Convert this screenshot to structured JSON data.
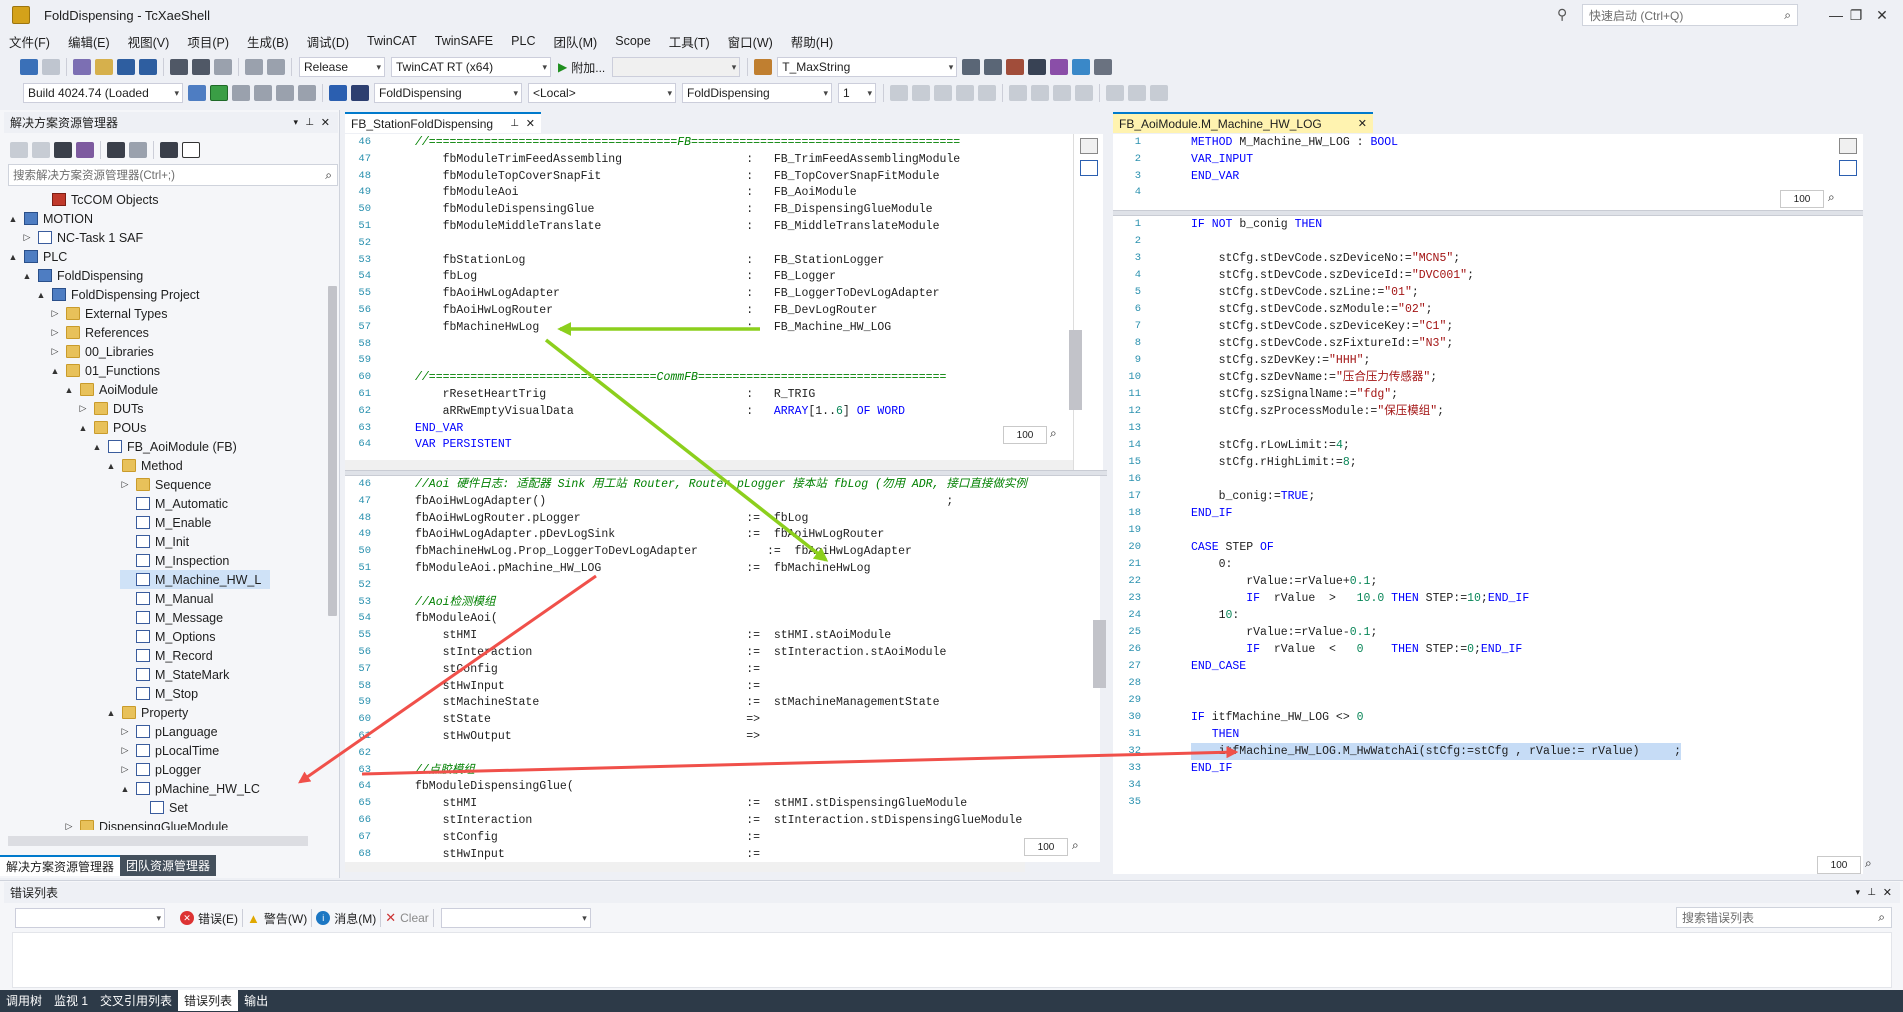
{
  "window": {
    "title": "FoldDispensing - TcXaeShell",
    "quick_launch_placeholder": "快速启动 (Ctrl+Q)"
  },
  "menu": [
    "文件(F)",
    "编辑(E)",
    "视图(V)",
    "项目(P)",
    "生成(B)",
    "调试(D)",
    "TwinCAT",
    "TwinSAFE",
    "PLC",
    "团队(M)",
    "Scope",
    "工具(T)",
    "窗口(W)",
    "帮助(H)"
  ],
  "toolbar1": {
    "config": "Release",
    "platform": "TwinCAT RT (x64)",
    "attach": "附加...",
    "symbol": "T_MaxString"
  },
  "toolbar2": {
    "build": "Build 4024.74 (Loaded",
    "project": "FoldDispensing",
    "target": "<Local>",
    "plc_project": "FoldDispensing",
    "instance": "1"
  },
  "solution_explorer": {
    "title": "解决方案资源管理器",
    "search_placeholder": "搜索解决方案资源管理器(Ctrl+;)",
    "nodes": [
      {
        "label": "TcCOM Objects"
      },
      {
        "label": "MOTION"
      },
      {
        "label": "NC-Task 1 SAF"
      },
      {
        "label": "PLC"
      },
      {
        "label": "FoldDispensing"
      },
      {
        "label": "FoldDispensing Project"
      },
      {
        "label": "External Types"
      },
      {
        "label": "References"
      },
      {
        "label": "00_Libraries"
      },
      {
        "label": "01_Functions"
      },
      {
        "label": "AoiModule"
      },
      {
        "label": "DUTs"
      },
      {
        "label": "POUs"
      },
      {
        "label": "FB_AoiModule (FB)"
      },
      {
        "label": "Method"
      },
      {
        "label": "Sequence"
      },
      {
        "label": "M_Automatic"
      },
      {
        "label": "M_Enable"
      },
      {
        "label": "M_Init"
      },
      {
        "label": "M_Inspection"
      },
      {
        "label": "M_Machine_HW_L"
      },
      {
        "label": "M_Manual"
      },
      {
        "label": "M_Message"
      },
      {
        "label": "M_Options"
      },
      {
        "label": "M_Record"
      },
      {
        "label": "M_StateMark"
      },
      {
        "label": "M_Stop"
      },
      {
        "label": "Property"
      },
      {
        "label": "pLanguage"
      },
      {
        "label": "pLocalTime"
      },
      {
        "label": "pLogger"
      },
      {
        "label": "pMachine_HW_LC"
      },
      {
        "label": "Set"
      },
      {
        "label": "DispensingGlueModule"
      }
    ],
    "bottom_tabs": [
      "解决方案资源管理器",
      "团队资源管理器"
    ]
  },
  "editor_left": {
    "tab": "FB_StationFoldDispensing",
    "zoom": "100",
    "top_lines": [
      {
        "n": "46",
        "t": "//====================================FB======================================="
      },
      {
        "n": "47",
        "t": "    fbModuleTrimFeedAssembling                  :   FB_TrimFeedAssemblingModule"
      },
      {
        "n": "48",
        "t": "    fbModuleTopCoverSnapFit                     :   FB_TopCoverSnapFitModule"
      },
      {
        "n": "49",
        "t": "    fbModuleAoi                                 :   FB_AoiModule"
      },
      {
        "n": "50",
        "t": "    fbModuleDispensingGlue                      :   FB_DispensingGlueModule"
      },
      {
        "n": "51",
        "t": "    fbModuleMiddleTranslate                     :   FB_MiddleTranslateModule"
      },
      {
        "n": "52",
        "t": ""
      },
      {
        "n": "53",
        "t": "    fbStationLog                                :   FB_StationLogger"
      },
      {
        "n": "54",
        "t": "    fbLog                                       :   FB_Logger"
      },
      {
        "n": "55",
        "t": "    fbAoiHwLogAdapter                           :   FB_LoggerToDevLogAdapter"
      },
      {
        "n": "56",
        "t": "    fbAoiHwLogRouter                            :   FB_DevLogRouter"
      },
      {
        "n": "57",
        "t": "    fbMachineHwLog                              :   FB_Machine_HW_LOG"
      },
      {
        "n": "58",
        "t": ""
      },
      {
        "n": "59",
        "t": ""
      },
      {
        "n": "60",
        "t": "//=================================CommFB===================================="
      },
      {
        "n": "61",
        "t": "    rResetHeartTrig                             :   R_TRIG"
      },
      {
        "n": "62",
        "t": "    aRRwEmptyVisualData                         :   ARRAY[1..6] OF WORD"
      },
      {
        "n": "63",
        "t": "END_VAR"
      },
      {
        "n": "64",
        "t": "VAR PERSISTENT"
      }
    ],
    "bottom_lines": [
      {
        "n": "46",
        "t": "//Aoi 硬件日志: 适配器 Sink 用工站 Router, Router.pLogger 接本站 fbLog (勿用 ADR, 接口直接做实例"
      },
      {
        "n": "47",
        "t": "fbAoiHwLogAdapter()                                                          ;"
      },
      {
        "n": "48",
        "t": "fbAoiHwLogRouter.pLogger                        :=  fbLog"
      },
      {
        "n": "49",
        "t": "fbAoiHwLogAdapter.pDevLogSink                   :=  fbAoiHwLogRouter"
      },
      {
        "n": "50",
        "t": "fbMachineHwLog.Prop_LoggerToDevLogAdapter          :=  fbAoiHwLogAdapter"
      },
      {
        "n": "51",
        "t": "fbModuleAoi.pMachine_HW_LOG                     :=  fbMachineHwLog"
      },
      {
        "n": "52",
        "t": ""
      },
      {
        "n": "53",
        "t": "//Aoi检测模组"
      },
      {
        "n": "54",
        "t": "fbModuleAoi("
      },
      {
        "n": "55",
        "t": "    stHMI                                       :=  stHMI.stAoiModule"
      },
      {
        "n": "56",
        "t": "    stInteraction                               :=  stInteraction.stAoiModule"
      },
      {
        "n": "57",
        "t": "    stConfig                                    :="
      },
      {
        "n": "58",
        "t": "    stHwInput                                   :="
      },
      {
        "n": "59",
        "t": "    stMachineState                              :=  stMachineManagementState"
      },
      {
        "n": "60",
        "t": "    stState                                     =>"
      },
      {
        "n": "61",
        "t": "    stHwOutput                                  =>"
      },
      {
        "n": "62",
        "t": ""
      },
      {
        "n": "63",
        "t": "//点胶模组"
      },
      {
        "n": "64",
        "t": "fbModuleDispensingGlue("
      },
      {
        "n": "65",
        "t": "    stHMI                                       :=  stHMI.stDispensingGlueModule"
      },
      {
        "n": "66",
        "t": "    stInteraction                               :=  stInteraction.stDispensingGlueModule"
      },
      {
        "n": "67",
        "t": "    stConfig                                    :="
      },
      {
        "n": "68",
        "t": "    stHwInput                                   :="
      }
    ]
  },
  "editor_right": {
    "tab": "FB_AoiModule.M_Machine_HW_LOG",
    "zoom": "100",
    "decl_lines": [
      {
        "n": "1",
        "t": "METHOD M_Machine_HW_LOG : BOOL"
      },
      {
        "n": "2",
        "t": "VAR_INPUT"
      },
      {
        "n": "3",
        "t": "END_VAR"
      },
      {
        "n": "4",
        "t": ""
      }
    ],
    "body_lines": [
      {
        "n": "1",
        "t": "IF NOT b_conig THEN"
      },
      {
        "n": "2",
        "t": ""
      },
      {
        "n": "3",
        "t": "    stCfg.stDevCode.szDeviceNo:=\"MCN5\";"
      },
      {
        "n": "4",
        "t": "    stCfg.stDevCode.szDeviceId:=\"DVC001\";"
      },
      {
        "n": "5",
        "t": "    stCfg.stDevCode.szLine:=\"01\";"
      },
      {
        "n": "6",
        "t": "    stCfg.stDevCode.szModule:=\"02\";"
      },
      {
        "n": "7",
        "t": "    stCfg.stDevCode.szDeviceKey:=\"C1\";"
      },
      {
        "n": "8",
        "t": "    stCfg.stDevCode.szFixtureId:=\"N3\";"
      },
      {
        "n": "9",
        "t": "    stCfg.szDevKey:=\"HHH\";"
      },
      {
        "n": "10",
        "t": "    stCfg.szDevName:=\"压合压力传感器\";"
      },
      {
        "n": "11",
        "t": "    stCfg.szSignalName:=\"fdg\";"
      },
      {
        "n": "12",
        "t": "    stCfg.szProcessModule:=\"保压模组\";"
      },
      {
        "n": "13",
        "t": ""
      },
      {
        "n": "14",
        "t": "    stCfg.rLowLimit:=4;"
      },
      {
        "n": "15",
        "t": "    stCfg.rHighLimit:=8;"
      },
      {
        "n": "16",
        "t": ""
      },
      {
        "n": "17",
        "t": "    b_conig:=TRUE;"
      },
      {
        "n": "18",
        "t": "END_IF"
      },
      {
        "n": "19",
        "t": ""
      },
      {
        "n": "20",
        "t": "CASE STEP OF"
      },
      {
        "n": "21",
        "t": "    0:"
      },
      {
        "n": "22",
        "t": "        rValue:=rValue+0.1;"
      },
      {
        "n": "23",
        "t": "        IF  rValue  >   10.0 THEN STEP:=10;END_IF"
      },
      {
        "n": "24",
        "t": "    10:"
      },
      {
        "n": "25",
        "t": "        rValue:=rValue-0.1;"
      },
      {
        "n": "26",
        "t": "        IF  rValue  <   0    THEN STEP:=0;END_IF"
      },
      {
        "n": "27",
        "t": "END_CASE"
      },
      {
        "n": "28",
        "t": ""
      },
      {
        "n": "29",
        "t": ""
      },
      {
        "n": "30",
        "t": "IF itfMachine_HW_LOG <> 0"
      },
      {
        "n": "31",
        "t": "   THEN"
      },
      {
        "n": "32",
        "t": "    itfMachine_HW_LOG.M_HwWatchAi(stCfg:=stCfg , rValue:= rValue)     ;"
      },
      {
        "n": "33",
        "t": "END_IF"
      },
      {
        "n": "34",
        "t": ""
      },
      {
        "n": "35",
        "t": ""
      }
    ]
  },
  "error_list": {
    "title": "错误列表",
    "errors": "错误(E)",
    "warnings": "警告(W)",
    "messages": "消息(M)",
    "clear": "Clear",
    "search_placeholder": "搜索错误列表"
  },
  "bottom_tabs": [
    "调用树",
    "监视 1",
    "交叉引用列表",
    "错误列表",
    "输出"
  ],
  "colors": {
    "accent": "#007acc",
    "arrow_green": "#8ccf1d",
    "arrow_red": "#f0504a"
  }
}
